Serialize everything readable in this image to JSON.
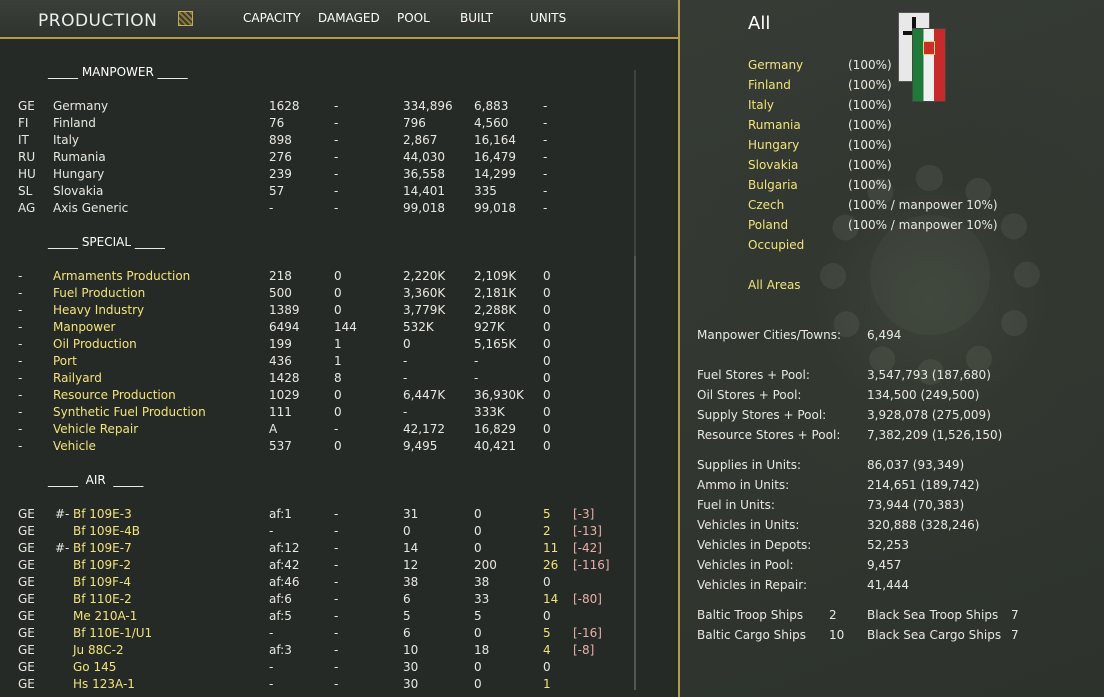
{
  "header": {
    "title": "PRODUCTION",
    "columns": [
      "CAPACITY",
      "DAMAGED",
      "POOL",
      "BUILT",
      "UNITS"
    ]
  },
  "sections": {
    "manpower": "_____ MANPOWER _____",
    "special": "_____ SPECIAL _____",
    "air": "_____  AIR  _____"
  },
  "manpower_rows": [
    {
      "code": "GE",
      "name": "Germany",
      "capacity": "1628",
      "damaged": "-",
      "pool": "334,896",
      "built": "6,883",
      "units": "-"
    },
    {
      "code": "FI",
      "name": "Finland",
      "capacity": "76",
      "damaged": "-",
      "pool": "796",
      "built": "4,560",
      "units": "-"
    },
    {
      "code": "IT",
      "name": "Italy",
      "capacity": "898",
      "damaged": "-",
      "pool": "2,867",
      "built": "16,164",
      "units": "-"
    },
    {
      "code": "RU",
      "name": "Rumania",
      "capacity": "276",
      "damaged": "-",
      "pool": "44,030",
      "built": "16,479",
      "units": "-"
    },
    {
      "code": "HU",
      "name": "Hungary",
      "capacity": "239",
      "damaged": "-",
      "pool": "36,558",
      "built": "14,299",
      "units": "-"
    },
    {
      "code": "SL",
      "name": "Slovakia",
      "capacity": "57",
      "damaged": "-",
      "pool": "14,401",
      "built": "335",
      "units": "-"
    },
    {
      "code": "AG",
      "name": "Axis Generic",
      "capacity": "-",
      "damaged": "-",
      "pool": "99,018",
      "built": "99,018",
      "units": "-"
    }
  ],
  "special_rows": [
    {
      "code": "-",
      "name": "Armaments Production",
      "capacity": "218",
      "damaged": "0",
      "pool": "2,220K",
      "built": "2,109K",
      "units": "0"
    },
    {
      "code": "-",
      "name": "Fuel Production",
      "capacity": "500",
      "damaged": "0",
      "pool": "3,360K",
      "built": "2,181K",
      "units": "0"
    },
    {
      "code": "-",
      "name": "Heavy Industry",
      "capacity": "1389",
      "damaged": "0",
      "pool": "3,779K",
      "built": "2,288K",
      "units": "0"
    },
    {
      "code": "-",
      "name": "Manpower",
      "capacity": "6494",
      "damaged": "144",
      "pool": "532K",
      "built": "927K",
      "units": "0"
    },
    {
      "code": "-",
      "name": "Oil Production",
      "capacity": "199",
      "damaged": "1",
      "pool": "0",
      "built": "5,165K",
      "units": "0"
    },
    {
      "code": "-",
      "name": "Port",
      "capacity": "436",
      "damaged": "1",
      "pool": "-",
      "built": "-",
      "units": "0"
    },
    {
      "code": "-",
      "name": "Railyard",
      "capacity": "1428",
      "damaged": "8",
      "pool": "-",
      "built": "-",
      "units": "0"
    },
    {
      "code": "-",
      "name": "Resource Production",
      "capacity": "1029",
      "damaged": "0",
      "pool": "6,447K",
      "built": "36,930K",
      "units": "0"
    },
    {
      "code": "-",
      "name": "Synthetic Fuel Production",
      "capacity": "111",
      "damaged": "0",
      "pool": "-",
      "built": "333K",
      "units": "0"
    },
    {
      "code": "-",
      "name": "Vehicle Repair",
      "capacity": "A",
      "damaged": "-",
      "pool": "42,172",
      "built": "16,829",
      "units": "0"
    },
    {
      "code": "-",
      "name": "Vehicle",
      "capacity": "537",
      "damaged": "0",
      "pool": "9,495",
      "built": "40,421",
      "units": "0"
    }
  ],
  "air_rows": [
    {
      "code": "GE",
      "mark": "#-",
      "name": "Bf 109E-3",
      "capacity": "af:1",
      "damaged": "-",
      "pool": "31",
      "built": "0",
      "units": "5",
      "delta": "[-3]",
      "hl": true
    },
    {
      "code": "GE",
      "mark": "",
      "name": "Bf 109E-4B",
      "capacity": "-",
      "damaged": "-",
      "pool": "0",
      "built": "0",
      "units": "2",
      "delta": "[-13]",
      "hl": true
    },
    {
      "code": "GE",
      "mark": "#-",
      "name": "Bf 109E-7",
      "capacity": "af:12",
      "damaged": "-",
      "pool": "14",
      "built": "0",
      "units": "11",
      "delta": "[-42]",
      "hl": true
    },
    {
      "code": "GE",
      "mark": "",
      "name": "Bf 109F-2",
      "capacity": "af:42",
      "damaged": "-",
      "pool": "12",
      "built": "200",
      "units": "26",
      "delta": "[-116]",
      "hl": true
    },
    {
      "code": "GE",
      "mark": "",
      "name": "Bf 109F-4",
      "capacity": "af:46",
      "damaged": "-",
      "pool": "38",
      "built": "38",
      "units": "0",
      "delta": "",
      "hl": false
    },
    {
      "code": "GE",
      "mark": "",
      "name": "Bf 110E-2",
      "capacity": "af:6",
      "damaged": "-",
      "pool": "6",
      "built": "33",
      "units": "14",
      "delta": "[-80]",
      "hl": true
    },
    {
      "code": "GE",
      "mark": "",
      "name": "Me 210A-1",
      "capacity": "af:5",
      "damaged": "-",
      "pool": "5",
      "built": "5",
      "units": "0",
      "delta": "",
      "hl": false
    },
    {
      "code": "GE",
      "mark": "",
      "name": "Bf 110E-1/U1",
      "capacity": "-",
      "damaged": "-",
      "pool": "6",
      "built": "0",
      "units": "5",
      "delta": "[-16]",
      "hl": true
    },
    {
      "code": "GE",
      "mark": "",
      "name": "Ju 88C-2",
      "capacity": "af:3",
      "damaged": "-",
      "pool": "10",
      "built": "18",
      "units": "4",
      "delta": "[-8]",
      "hl": true
    },
    {
      "code": "GE",
      "mark": "",
      "name": "Go 145",
      "capacity": "-",
      "damaged": "-",
      "pool": "30",
      "built": "0",
      "units": "0",
      "delta": "",
      "hl": false
    },
    {
      "code": "GE",
      "mark": "",
      "name": "Hs 123A-1",
      "capacity": "-",
      "damaged": "-",
      "pool": "30",
      "built": "0",
      "units": "1",
      "delta": "",
      "hl": true
    }
  ],
  "right": {
    "title": "All",
    "nations": [
      {
        "name": "Germany",
        "pct": "(100%)"
      },
      {
        "name": "Finland",
        "pct": "(100%)"
      },
      {
        "name": "Italy",
        "pct": "(100%)"
      },
      {
        "name": "Rumania",
        "pct": "(100%)"
      },
      {
        "name": "Hungary",
        "pct": "(100%)"
      },
      {
        "name": "Slovakia",
        "pct": "(100%)"
      },
      {
        "name": "Bulgaria",
        "pct": "(100%)"
      },
      {
        "name": "Czech",
        "pct": "(100% / manpower 10%)"
      },
      {
        "name": "Poland",
        "pct": "(100% / manpower 10%)"
      },
      {
        "name": "Occupied",
        "pct": ""
      }
    ],
    "all_areas": "All Areas",
    "manpower_label": "Manpower Cities/Towns:",
    "manpower_value": "6,494",
    "stores": [
      {
        "label": "Fuel Stores + Pool:",
        "value": "3,547,793 (187,680)"
      },
      {
        "label": "Oil Stores + Pool:",
        "value": "134,500 (249,500)"
      },
      {
        "label": "Supply Stores + Pool:",
        "value": "3,928,078 (275,009)"
      },
      {
        "label": "Resource Stores + Pool:",
        "value": "7,382,209 (1,526,150)"
      }
    ],
    "units": [
      {
        "label": "Supplies in Units:",
        "value": "86,037 (93,349)"
      },
      {
        "label": "Ammo in Units:",
        "value": "214,651 (189,742)"
      },
      {
        "label": "Fuel in Units:",
        "value": "73,944 (70,383)"
      },
      {
        "label": "Vehicles in Units:",
        "value": "320,888 (328,246)"
      },
      {
        "label": "Vehicles in Depots:",
        "value": "52,253"
      },
      {
        "label": "Vehicles in Pool:",
        "value": "9,457"
      },
      {
        "label": "Vehicles in Repair:",
        "value": "41,444"
      }
    ],
    "ships": [
      {
        "label": "Baltic Troop Ships",
        "count": "2",
        "label2": "Black Sea Troop Ships",
        "count2": "7"
      },
      {
        "label": "Baltic Cargo Ships",
        "count": "10",
        "label2": "Black Sea Cargo Ships",
        "count2": "7"
      }
    ]
  }
}
